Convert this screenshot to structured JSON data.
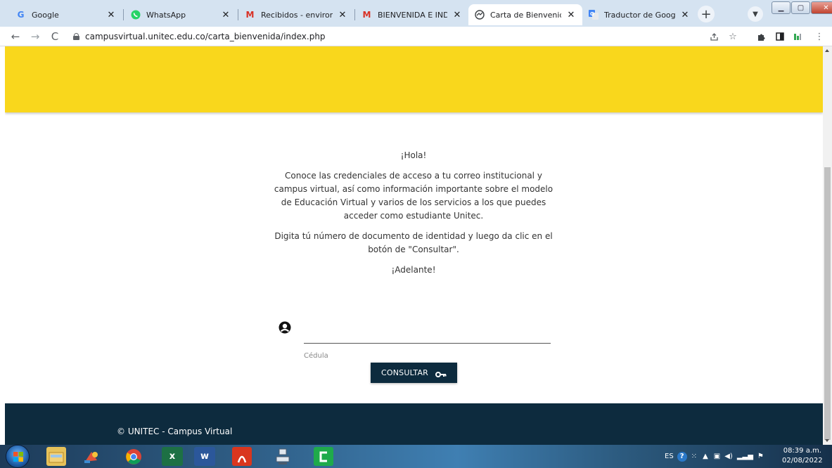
{
  "browser": {
    "tabs": [
      {
        "label": "Google",
        "favicon": "google-icon",
        "active": false
      },
      {
        "label": "WhatsApp",
        "favicon": "whatsapp-icon",
        "active": false
      },
      {
        "label": "Recibidos - environmen",
        "favicon": "gmail-icon",
        "active": false
      },
      {
        "label": "BIENVENIDA E INDUCC",
        "favicon": "gmail-icon",
        "active": false
      },
      {
        "label": "Carta de Bienvenida",
        "favicon": "globe-icon",
        "active": true
      },
      {
        "label": "Traductor de Google",
        "favicon": "translate-icon",
        "active": false
      }
    ],
    "url": "campusvirtual.unitec.edu.co/carta_bienvenida/index.php",
    "colors": {
      "tabstrip": "#d5e3f1"
    }
  },
  "page": {
    "banner_color": "#f9d71c",
    "intro": {
      "greeting": "¡Hola!",
      "paragraph1": "Conoce las credenciales de acceso a tu correo institucional y campus virtual, así como información importante sobre el modelo de Educación Virtual y varios de los servicios a los que puedes acceder como estudiante Unitec.",
      "paragraph2": "Digita tú número de documento de identidad y luego da clic en el botón de \"Consultar\".",
      "closing": "¡Adelante!"
    },
    "form": {
      "input_value": "",
      "input_label": "Cédula",
      "button_label": "CONSULTAR"
    },
    "footer": {
      "copyright": "© UNITEC - Campus Virtual",
      "color": "#0d2b3e"
    }
  },
  "taskbar": {
    "apps": [
      "start-button",
      "file-explorer-icon",
      "paint-icon",
      "chrome-icon",
      "excel-icon",
      "word-icon",
      "acrobat-icon",
      "network-icon",
      "camtasia-icon"
    ],
    "language": "ES",
    "time": "08:39 a.m.",
    "date": "02/08/2022"
  }
}
